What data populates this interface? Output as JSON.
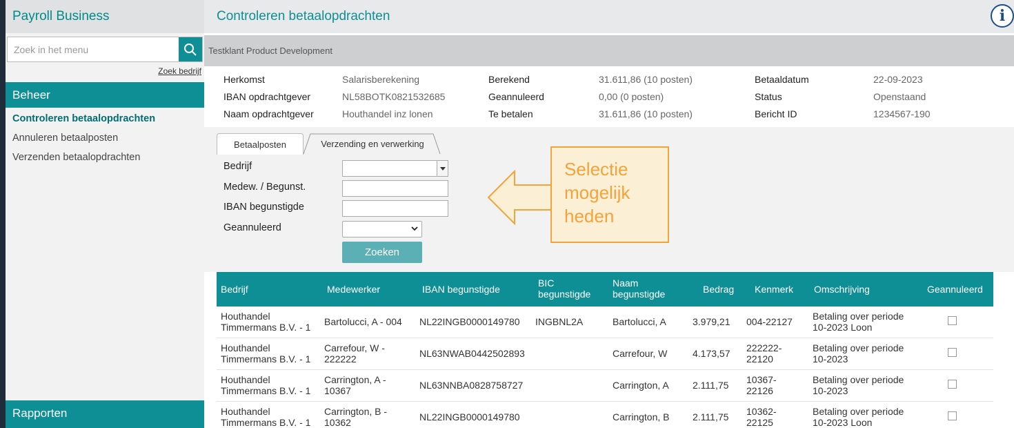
{
  "sidebar": {
    "brand": "Payroll Business",
    "search_placeholder": "Zoek in het menu",
    "zoek_bedrijf": "Zoek bedrijf",
    "section_beheer": "Beheer",
    "items": [
      {
        "label": "Controleren betaalopdrachten",
        "active": true
      },
      {
        "label": "Annuleren betaalposten",
        "active": false
      },
      {
        "label": "Verzenden betaalopdrachten",
        "active": false
      }
    ],
    "section_rapporten": "Rapporten"
  },
  "header": {
    "title": "Controleren betaalopdrachten",
    "client": "Testklant Product Development",
    "info_icon": "i"
  },
  "details": {
    "col1": [
      {
        "label": "Herkomst",
        "value": "Salarisberekening"
      },
      {
        "label": "IBAN opdrachtgever",
        "value": "NL58BOTK0821532685"
      },
      {
        "label": "Naam opdrachtgever",
        "value": "Houthandel inz lonen"
      }
    ],
    "col2": [
      {
        "label": "Berekend",
        "value": "31.611,86 (10 posten)"
      },
      {
        "label": "Geannuleerd",
        "value": "0,00 (0 posten)"
      },
      {
        "label": "Te betalen",
        "value": "31.611,86 (10 posten)"
      }
    ],
    "col3": [
      {
        "label": "Betaaldatum",
        "value": "22-09-2023"
      },
      {
        "label": "Status",
        "value": "Openstaand"
      },
      {
        "label": "Bericht ID",
        "value": "1234567-190"
      }
    ]
  },
  "tabs": [
    "Betaalposten",
    "Verzending en verwerking"
  ],
  "filters": {
    "bedrijf": "Bedrijf",
    "medew": "Medew. / Begunst.",
    "iban": "IBAN begunstigde",
    "geannuleerd": "Geannuleerd",
    "search_button": "Zoeken"
  },
  "callout": {
    "line1": "Selectie",
    "line2": "mogelijk",
    "line3": "heden"
  },
  "table": {
    "headers": {
      "bedrijf": "Bedrijf",
      "medewerker": "Medewerker",
      "iban": "IBAN begunstigde",
      "bic1": "BIC",
      "bic2": "begunstigde",
      "naam1": "Naam",
      "naam2": "begunstigde",
      "bedrag": "Bedrag",
      "kenmerk": "Kenmerk",
      "omschrijving": "Omschrijving",
      "geannuleerd": "Geannuleerd"
    },
    "rows": [
      {
        "bedrijf1": "Houthandel",
        "bedrijf2": "Timmermans B.V. - 1",
        "med1": "Bartolucci, A - 004",
        "med2": "",
        "iban": "NL22INGB0000149780",
        "bic": "INGBNL2A",
        "naam": "Bartolucci, A",
        "bedrag": "3.979,21",
        "ken1": "004-22127",
        "ken2": "",
        "oms1": "Betaling over periode",
        "oms2": "10-2023 Loon"
      },
      {
        "bedrijf1": "Houthandel",
        "bedrijf2": "Timmermans B.V. - 1",
        "med1": "Carrefour, W -",
        "med2": "222222",
        "iban": "NL63NWAB0442502893",
        "bic": "",
        "naam": "Carrefour, W",
        "bedrag": "4.173,57",
        "ken1": "222222-",
        "ken2": "22120",
        "oms1": "Betaling over periode",
        "oms2": "10-2023"
      },
      {
        "bedrijf1": "Houthandel",
        "bedrijf2": "Timmermans B.V. - 1",
        "med1": "Carrington, A -",
        "med2": "10367",
        "iban": "NL63NNBA0828758727",
        "bic": "",
        "naam": "Carrington, A",
        "bedrag": "2.111,75",
        "ken1": "10367-",
        "ken2": "22126",
        "oms1": "Betaling over periode",
        "oms2": "10-2023"
      },
      {
        "bedrijf1": "Houthandel",
        "bedrijf2": "Timmermans B.V. - 1",
        "med1": "Carrington, B -",
        "med2": "10362",
        "iban": "NL22INGB0000149780",
        "bic": "",
        "naam": "Carrington, B",
        "bedrag": "2.111,75",
        "ken1": "10362-",
        "ken2": "22125",
        "oms1": "Betaling over periode",
        "oms2": "10-2023 Loon"
      }
    ]
  }
}
